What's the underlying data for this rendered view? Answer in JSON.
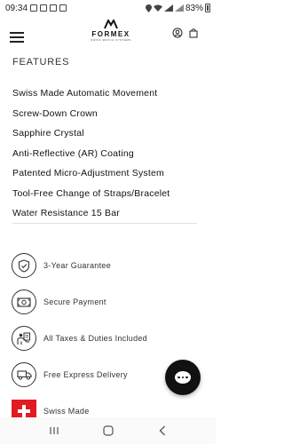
{
  "status_bar": {
    "time": "09:34",
    "battery": "83%"
  },
  "brand": {
    "name": "FORMEX",
    "tagline": "SWISS WATCH SYSTEMS"
  },
  "features": {
    "title": "FEATURES",
    "items": [
      "Swiss Made Automatic Movement",
      "Screw-Down Crown",
      "Sapphire Crystal",
      "Anti-Reflective (AR) Coating",
      "Patented Micro-Adjustment System",
      "Tool-Free Change of Straps/Bracelet",
      "Water Resistance 15 Bar"
    ]
  },
  "benefits": [
    {
      "icon": "shield-check-icon",
      "label": "3-Year Guarantee"
    },
    {
      "icon": "banknote-icon",
      "label": "Secure Payment"
    },
    {
      "icon": "taxes-icon",
      "label": "All Taxes & Duties Included"
    },
    {
      "icon": "truck-icon",
      "label": "Free Express Delivery"
    },
    {
      "icon": "swiss-flag-icon",
      "label": "Swiss Made"
    }
  ],
  "colors": {
    "accent": "#111111",
    "swiss_red": "#e21b23"
  }
}
